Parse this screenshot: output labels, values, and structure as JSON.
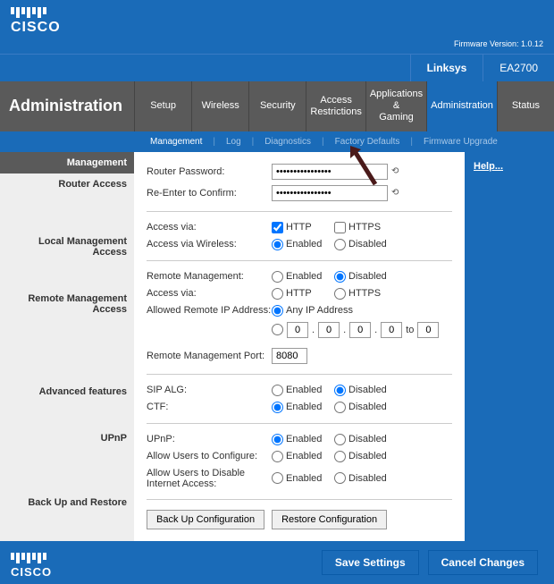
{
  "brand": "CISCO",
  "firmware": "Firmware Version: 1.0.12",
  "model": {
    "brand": "Linksys",
    "number": "EA2700"
  },
  "page_title": "Administration",
  "tabs": [
    "Setup",
    "Wireless",
    "Security",
    "Access\nRestrictions",
    "Applications &\nGaming",
    "Administration",
    "Status"
  ],
  "subtabs": [
    "Management",
    "Log",
    "Diagnostics",
    "Factory Defaults",
    "Firmware Upgrade"
  ],
  "help": "Help...",
  "sidebar": {
    "s0": "Management",
    "s1": "Router Access",
    "s2": "Local Management Access",
    "s3": "Remote Management\nAccess",
    "s4": "Advanced features",
    "s5": "UPnP",
    "s6": "Back Up and Restore"
  },
  "labels": {
    "router_pw": "Router Password:",
    "confirm_pw": "Re-Enter to Confirm:",
    "access_via": "Access via:",
    "access_wireless": "Access via Wireless:",
    "remote_mgmt": "Remote Management:",
    "allowed_ip": "Allowed Remote IP Address:",
    "any_ip": "Any IP Address",
    "remote_port": "Remote Management Port:",
    "sip_alg": "SIP ALG:",
    "ctf": "CTF:",
    "upnp": "UPnP:",
    "allow_config": "Allow Users to Configure:",
    "allow_disable": "Allow Users to Disable\nInternet Access:",
    "http": "HTTP",
    "https": "HTTPS",
    "enabled": "Enabled",
    "disabled": "Disabled",
    "to": "to",
    "dot": "."
  },
  "values": {
    "pw": "••••••••••••••••",
    "port": "8080",
    "ip": [
      "0",
      "0",
      "0",
      "0",
      "0"
    ]
  },
  "buttons": {
    "backup": "Back Up Configuration",
    "restore": "Restore Configuration",
    "save": "Save Settings",
    "cancel": "Cancel Changes"
  }
}
